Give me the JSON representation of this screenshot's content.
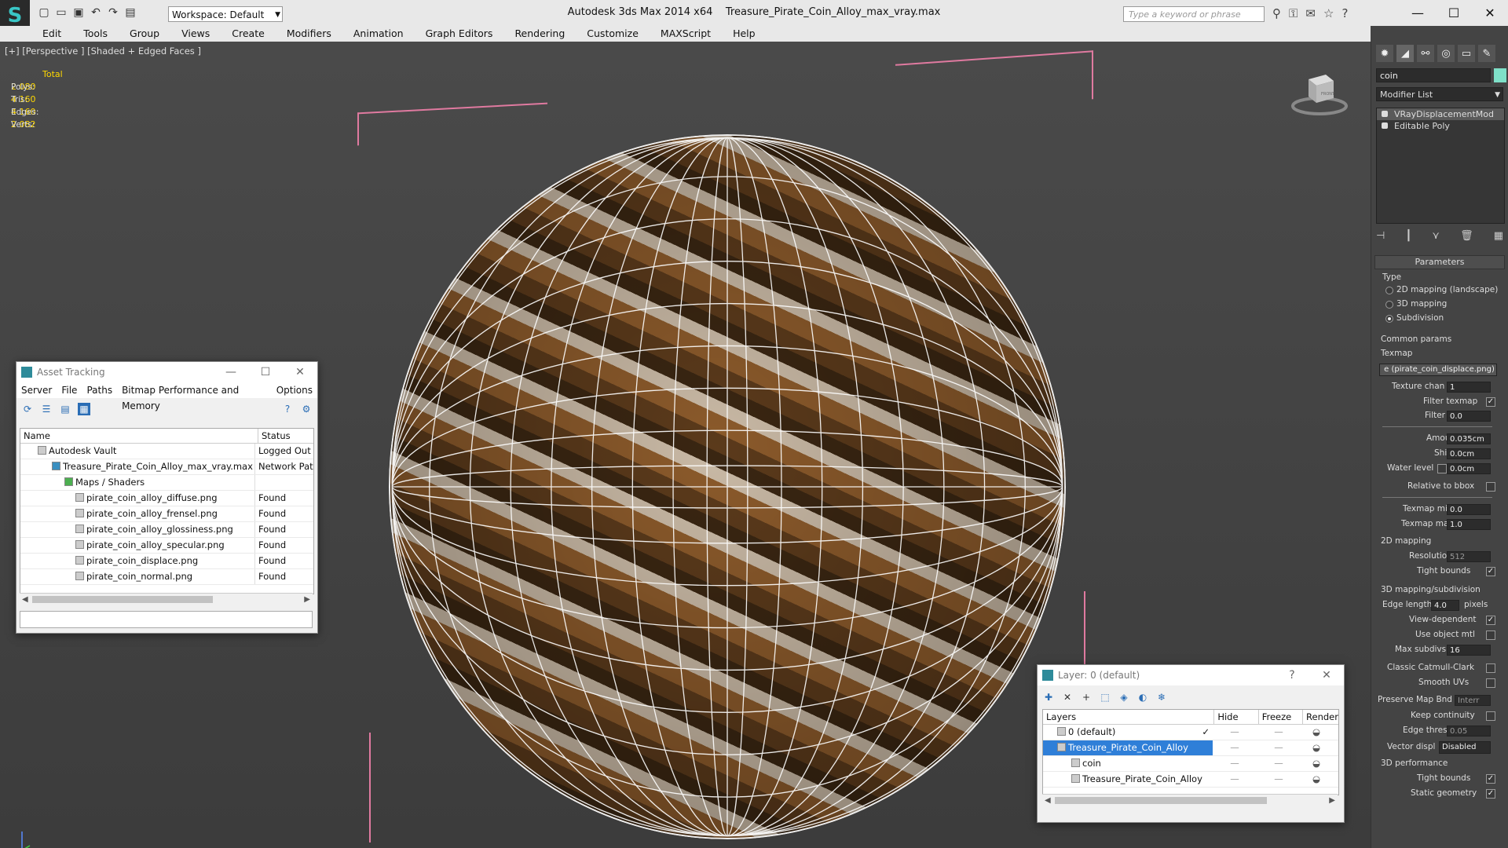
{
  "app": {
    "title": "Autodesk 3ds Max  2014 x64",
    "file": "Treasure_Pirate_Coin_Alloy_max_vray.max",
    "workspace": "Workspace: Default",
    "search_placeholder": "Type a keyword or phrase"
  },
  "menu": [
    "Edit",
    "Tools",
    "Group",
    "Views",
    "Create",
    "Modifiers",
    "Animation",
    "Graph Editors",
    "Rendering",
    "Customize",
    "MAXScript",
    "Help"
  ],
  "viewport": {
    "label": "[+] [Perspective ] [Shaded + Edged Faces ]",
    "stats": {
      "header": "Total",
      "rows": [
        {
          "label": "Polys:",
          "value": "2 080"
        },
        {
          "label": "Tris:",
          "value": "4 160"
        },
        {
          "label": "Edges:",
          "value": "4 160"
        },
        {
          "label": "Verts:",
          "value": "2 082"
        }
      ]
    },
    "viewcube_label": "FRONT"
  },
  "command_panel": {
    "object_name": "coin",
    "modifier_list": "Modifier List",
    "stack": [
      "VRayDisplacementMod",
      "Editable Poly"
    ],
    "rollout": "Parameters",
    "type_label": "Type",
    "type_options": [
      "2D mapping (landscape)",
      "3D mapping",
      "Subdivision"
    ],
    "common_params": "Common params",
    "texmap_label": "Texmap",
    "texmap_value": "e (pirate_coin_displace.png)",
    "texture_chan_label": "Texture chan",
    "texture_chan": "1",
    "filter_texmap_label": "Filter texmap",
    "filter_blur_label": "Filter blur",
    "filter_blur": "0.0",
    "amount_label": "Amount",
    "amount": "0.035cm",
    "shift_label": "Shift",
    "shift": "0.0cm",
    "water_level_label": "Water level",
    "water_level": "0.0cm",
    "relative_bbox_label": "Relative to bbox",
    "texmap_min_label": "Texmap min",
    "texmap_min": "0.0",
    "texmap_max_label": "Texmap max",
    "texmap_max": "1.0",
    "mapping2d": "2D mapping",
    "resolution_label": "Resolution",
    "resolution": "512",
    "tight_bounds_label": "Tight bounds",
    "mapping3d": "3D mapping/subdivision",
    "edge_length_label": "Edge length",
    "edge_length": "4.0",
    "pixels": "pixels",
    "view_dependent_label": "View-dependent",
    "use_object_mtl_label": "Use object mtl",
    "max_subdivs_label": "Max subdivs",
    "max_subdivs": "16",
    "catmull_label": "Classic Catmull-Clark",
    "smooth_uvs_label": "Smooth UVs",
    "preserve_map_label": "Preserve Map Bnd",
    "preserve_map": "Interr",
    "keep_continuity_label": "Keep continuity",
    "edge_thresh_label": "Edge thresh",
    "edge_thresh": "0.05",
    "vector_displ_label": "Vector displ",
    "vector_displ": "Disabled",
    "perf3d": "3D performance",
    "tight_bounds2_label": "Tight bounds",
    "static_geometry_label": "Static geometry"
  },
  "asset_tracking": {
    "title": "Asset Tracking",
    "menu": [
      "Server",
      "File",
      "Paths",
      "Bitmap Performance and Memory",
      "Options"
    ],
    "col_name": "Name",
    "col_status": "Status",
    "rows": [
      {
        "name": "Autodesk Vault",
        "status": "Logged Out"
      },
      {
        "name": "Treasure_Pirate_Coin_Alloy_max_vray.max",
        "status": "Network Pat"
      },
      {
        "name": "Maps / Shaders",
        "status": ""
      },
      {
        "name": "pirate_coin_alloy_diffuse.png",
        "status": "Found"
      },
      {
        "name": "pirate_coin_alloy_frensel.png",
        "status": "Found"
      },
      {
        "name": "pirate_coin_alloy_glossiness.png",
        "status": "Found"
      },
      {
        "name": "pirate_coin_alloy_specular.png",
        "status": "Found"
      },
      {
        "name": "pirate_coin_displace.png",
        "status": "Found"
      },
      {
        "name": "pirate_coin_normal.png",
        "status": "Found"
      }
    ]
  },
  "layer_dialog": {
    "title": "Layer: 0 (default)",
    "help": "?",
    "col_layers": "Layers",
    "col_hide": "Hide",
    "col_freeze": "Freeze",
    "col_render": "Render",
    "rows": [
      {
        "name": "0 (default)"
      },
      {
        "name": "Treasure_Pirate_Coin_Alloy"
      },
      {
        "name": "coin"
      },
      {
        "name": "Treasure_Pirate_Coin_Alloy"
      }
    ]
  }
}
